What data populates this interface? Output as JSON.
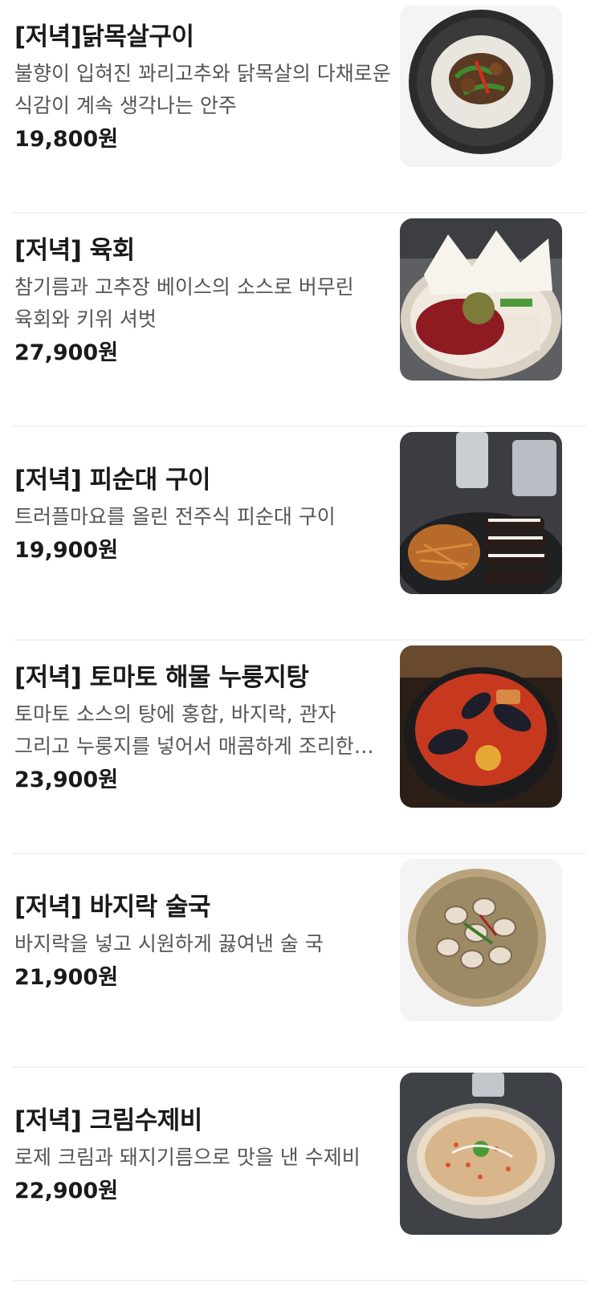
{
  "menu": {
    "items": [
      {
        "name": "[저녁]닭목살구이",
        "description": "불향이 입혀진 꽈리고추와 닭목살의 다채로운 식감이 계속 생각나는 안주",
        "price": "19,800원",
        "image_icon": "dish-photo"
      },
      {
        "name": "[저녁] 육회",
        "description": "참기름과 고추장 베이스의 소스로 버무린 육회와 키위 셔벗",
        "price": "27,900원",
        "image_icon": "dish-photo"
      },
      {
        "name": "[저녁] 피순대 구이",
        "description": "트러플마요를 올린 전주식 피순대 구이",
        "price": "19,900원",
        "image_icon": "dish-photo"
      },
      {
        "name": "[저녁] 토마토 해물 누룽지탕",
        "description": "토마토 소스의 탕에 홍합, 바지락, 관자 그리고 누룽지를 넣어서 매콤하게 조리한 요리",
        "price": "23,900원",
        "image_icon": "dish-photo"
      },
      {
        "name": "[저녁] 바지락 술국",
        "description": "바지락을 넣고 시원하게 끓여낸 술 국",
        "price": "21,900원",
        "image_icon": "dish-photo"
      },
      {
        "name": "[저녁] 크림수제비",
        "description": "로제 크림과 돼지기름으로 맛을 낸 수제비",
        "price": "22,900원",
        "image_icon": "dish-photo"
      }
    ]
  }
}
